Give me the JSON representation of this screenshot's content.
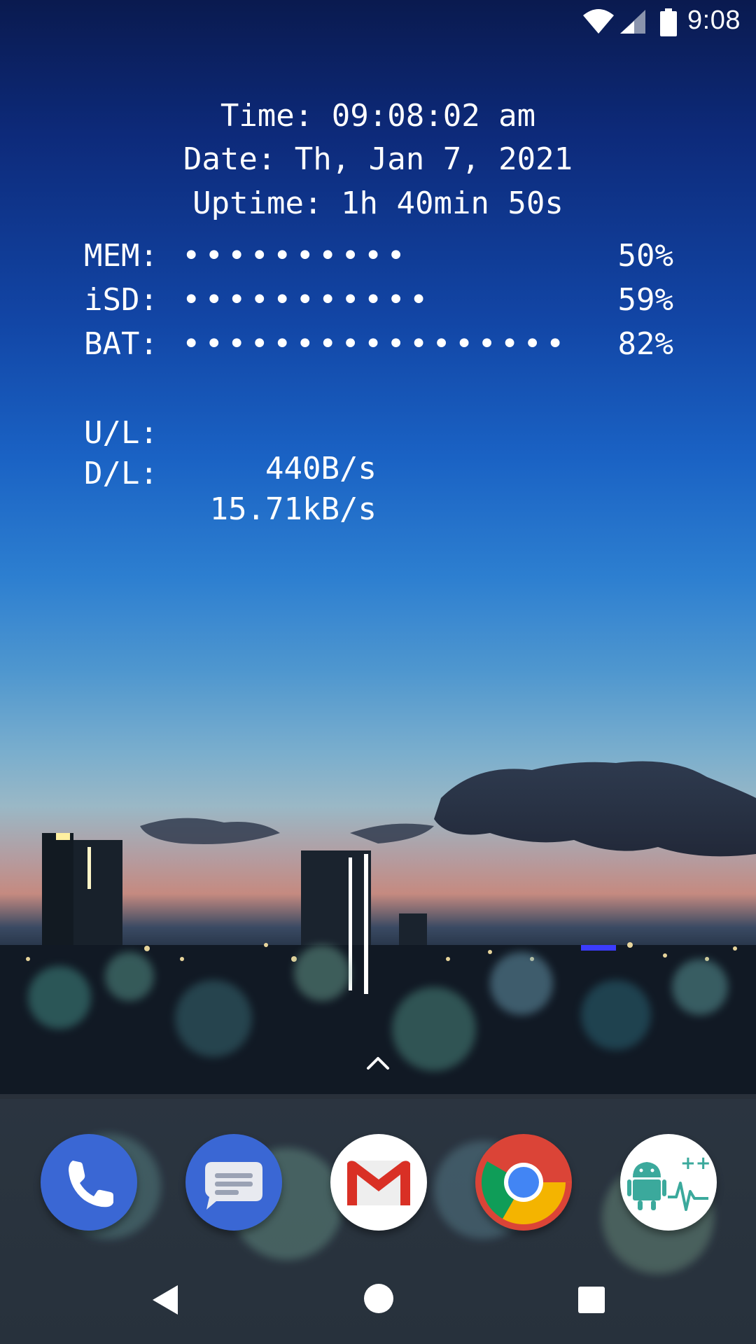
{
  "status_bar": {
    "time": "9:08",
    "icons": [
      "wifi-icon",
      "cellular-signal-icon",
      "battery-icon"
    ]
  },
  "monitor": {
    "time_line": "Time: 09:08:02 am",
    "date_line": "Date: Th, Jan 7, 2021",
    "uptime_line": "Uptime: 1h 40min 50s",
    "bars": [
      {
        "label": "MEM:",
        "dots": "••••••••••",
        "percent": "50%"
      },
      {
        "label": "iSD:",
        "dots": "•••••••••••",
        "percent": "59%"
      },
      {
        "label": "BAT:",
        "dots": "•••••••••••••••••",
        "percent": "82%"
      }
    ],
    "network": [
      {
        "label": "U/L:",
        "value": "440B/s"
      },
      {
        "label": "D/L:",
        "value": "15.71kB/s"
      }
    ]
  },
  "dock": {
    "apps": [
      "phone-app",
      "messages-app",
      "gmail-app",
      "chrome-app",
      "system-monitor-app"
    ]
  },
  "navigation": {
    "buttons": [
      "back",
      "home",
      "recents"
    ]
  },
  "colors": {
    "phone_bg": "#3a67d4",
    "messages_bg": "#3a67d4",
    "chrome_red": "#db4437",
    "chrome_yellow": "#f4b400",
    "chrome_green": "#0f9d58",
    "chrome_blue": "#4285f4",
    "android_green": "#3ba99c"
  }
}
